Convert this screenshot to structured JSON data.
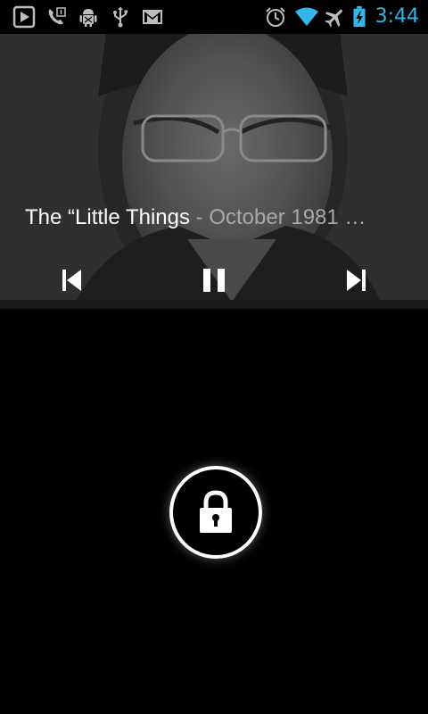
{
  "status_bar": {
    "time": "3:44",
    "left_icons": [
      "play-store-icon",
      "phone-call-icon",
      "android-debug-icon",
      "usb-icon",
      "gmail-icon"
    ],
    "right_icons": [
      "alarm-icon",
      "wifi-icon",
      "airplane-icon",
      "battery-charging-icon"
    ],
    "accent_color": "#33b5e5"
  },
  "media": {
    "track_title": "The “Little Things",
    "separator": " - ",
    "track_subtitle": "October 1981 …",
    "controls": [
      "previous-icon",
      "pause-icon",
      "next-icon"
    ]
  },
  "lock": {
    "icon": "lock-icon"
  }
}
